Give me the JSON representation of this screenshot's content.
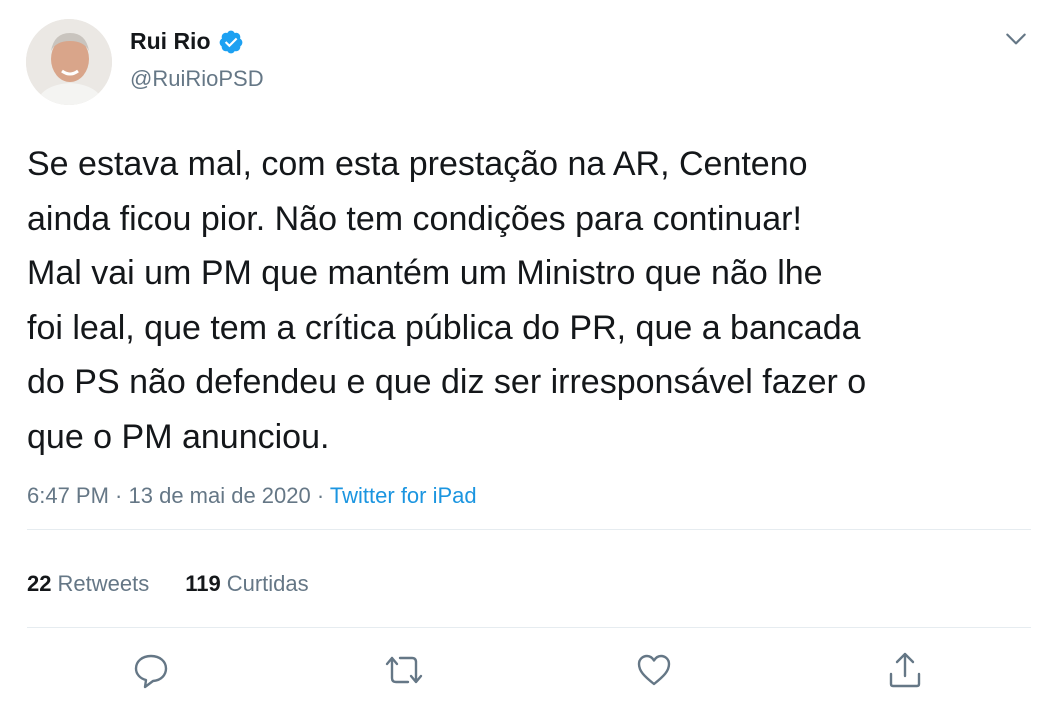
{
  "author": {
    "name": "Rui Rio",
    "handle": "@RuiRioPSD"
  },
  "tweet": {
    "text": "Se estava mal, com esta prestação na AR, Centeno\nainda ficou pior. Não tem condições para continuar!\nMal vai um PM que mantém um Ministro que não lhe\nfoi leal, que tem a crítica pública do PR, que a bancada\ndo PS não defendeu e que diz ser irresponsável fazer o\nque o PM anunciou.",
    "time": "6:47 PM",
    "separator1": " · ",
    "date": "13 de mai de 2020",
    "separator2": " · ",
    "source": "Twitter for iPad"
  },
  "stats": {
    "retweets_count": "22",
    "retweets_label": "Retweets",
    "likes_count": "119",
    "likes_label": "Curtidas"
  },
  "icons": {
    "verified": "verified-badge-icon",
    "caret": "chevron-down-icon",
    "reply": "reply-icon",
    "retweet": "retweet-icon",
    "like": "heart-icon",
    "share": "share-icon"
  },
  "colors": {
    "text": "#14171a",
    "secondary": "#657786",
    "accent": "#1b95e0",
    "divider": "#e6ecf0"
  }
}
